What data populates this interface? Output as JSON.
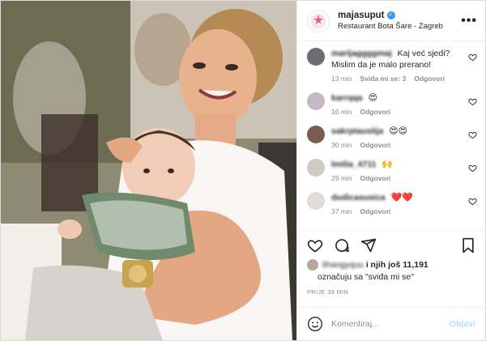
{
  "header": {
    "username": "majasuput",
    "location": "Restaurant Bota Šare - Zagreb",
    "verified_mark": "✓",
    "more_label": "•••"
  },
  "comments": [
    {
      "user": "marijaggggmaj",
      "text": "Kaj već sjedi? Mislim da je malo prerano!",
      "time": "13 min",
      "likes": "Sviđa mi se: 3",
      "reply": "Odgovori",
      "avatar_color": "#6f6a72"
    },
    {
      "user": "karrqqa",
      "text": "😍",
      "time": "16 min",
      "reply": "Odgovori",
      "avatar_color": "#c7b8c6"
    },
    {
      "user": "sakrptauslija",
      "text": "😍😍",
      "time": "30 min",
      "reply": "Odgovori",
      "avatar_color": "#7a5b52"
    },
    {
      "user": "lmilia_4711",
      "text": "🙌",
      "time": "29 min",
      "reply": "Odgovori",
      "avatar_color": "#cfcac4"
    },
    {
      "user": "dudicasusica",
      "text": "❤️❤️",
      "time": "37 min",
      "reply": "Odgovori",
      "avatar_color": "#e2dcd9"
    }
  ],
  "actions": {
    "icons": [
      "heart-icon",
      "comment-icon",
      "share-icon",
      "bookmark-icon"
    ]
  },
  "likes": {
    "liker": "lihangyquu",
    "and_others": "i njih još 11,191",
    "suffix": "označuju sa \"sviđa mi se\""
  },
  "post_time": "PRIJE 39 MIN",
  "add_comment": {
    "placeholder": "Komentiraj...",
    "post_label": "Objavi"
  },
  "colors": {
    "accent_link": "#b2dffc",
    "verified": "#3897f0",
    "muted_text": "#8e8e8e",
    "brand_pink": "#e35b86"
  }
}
